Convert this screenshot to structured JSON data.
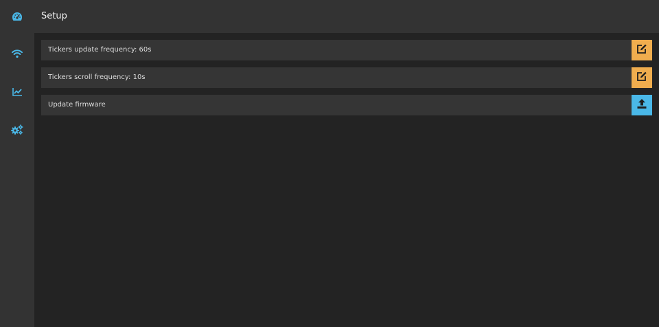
{
  "header": {
    "title": "Setup"
  },
  "sidebar": {
    "items": [
      {
        "icon": "dashboard-gauge-icon"
      },
      {
        "icon": "wifi-icon"
      },
      {
        "icon": "chart-line-icon"
      },
      {
        "icon": "cogs-icon"
      }
    ],
    "accent_color": "#4ab8e8"
  },
  "settings": {
    "rows": [
      {
        "label": "Tickers update frequency: 60s",
        "action_icon": "edit-icon",
        "action_color": "#f0ad4e"
      },
      {
        "label": "Tickers scroll frequency: 10s",
        "action_icon": "edit-icon",
        "action_color": "#f0ad4e"
      },
      {
        "label": "Update firmware",
        "action_icon": "upload-icon",
        "action_color": "#4ab8e8"
      }
    ]
  }
}
